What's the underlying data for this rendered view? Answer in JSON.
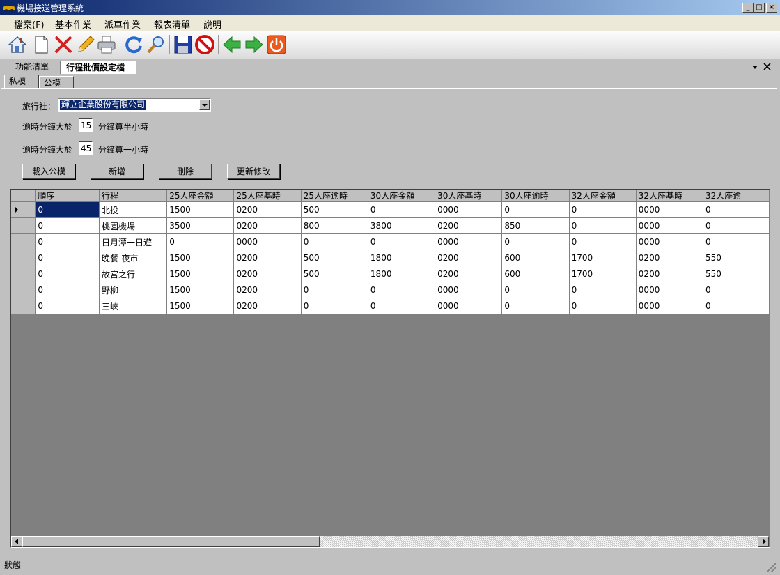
{
  "window": {
    "title": "機場接送管理系統"
  },
  "menu": {
    "items": [
      "檔案(F)",
      "基本作業",
      "派車作業",
      "報表清單",
      "說明"
    ]
  },
  "toolbar": {
    "icons": [
      "home-icon",
      "new-document-icon",
      "delete-icon",
      "edit-pencil-icon",
      "print-icon",
      "refresh-icon",
      "search-icon",
      "save-icon",
      "stop-icon",
      "back-arrow-icon",
      "forward-arrow-icon",
      "power-icon"
    ]
  },
  "doc_tabs": {
    "tab1": "功能清單",
    "tab2": "行程批價設定檔"
  },
  "inner_tabs": {
    "private": "私模",
    "public": "公模"
  },
  "form": {
    "agency_label": "旅行社：",
    "agency_value": "輝立企業股份有限公司",
    "overtime1_prefix": "逾時分鐘大於",
    "overtime1_value": "15",
    "overtime1_suffix": "分鐘算半小時",
    "overtime2_prefix": "逾時分鐘大於",
    "overtime2_value": "45",
    "overtime2_suffix": "分鐘算一小時"
  },
  "buttons": {
    "load": "載入公模",
    "add": "新增",
    "delete": "刪除",
    "update": "更新修改"
  },
  "grid": {
    "columns": [
      "順序",
      "行程",
      "25人座金額",
      "25人座基時",
      "25人座逾時",
      "30人座金額",
      "30人座基時",
      "30人座逾時",
      "32人座金額",
      "32人座基時",
      "32人座逾"
    ],
    "rows": [
      [
        "0",
        "北投",
        "1500",
        "0200",
        "500",
        "0",
        "0000",
        "0",
        "0",
        "0000",
        "0"
      ],
      [
        "0",
        "桃園機場",
        "3500",
        "0200",
        "800",
        "3800",
        "0200",
        "850",
        "0",
        "0000",
        "0"
      ],
      [
        "0",
        "日月潭一日遊",
        "0",
        "0000",
        "0",
        "0",
        "0000",
        "0",
        "0",
        "0000",
        "0"
      ],
      [
        "0",
        "晚餐-夜市",
        "1500",
        "0200",
        "500",
        "1800",
        "0200",
        "600",
        "1700",
        "0200",
        "550"
      ],
      [
        "0",
        "故宮之行",
        "1500",
        "0200",
        "500",
        "1800",
        "0200",
        "600",
        "1700",
        "0200",
        "550"
      ],
      [
        "0",
        "野柳",
        "1500",
        "0200",
        "0",
        "0",
        "0000",
        "0",
        "0",
        "0000",
        "0"
      ],
      [
        "0",
        "三峽",
        "1500",
        "0200",
        "0",
        "0",
        "0000",
        "0",
        "0",
        "0000",
        "0"
      ]
    ]
  },
  "status": {
    "text": "狀態"
  },
  "colors": {
    "titlebar": "#0a246a",
    "selection": "#0a246a",
    "face": "#c0c0c0",
    "grid_bg": "#808080"
  }
}
